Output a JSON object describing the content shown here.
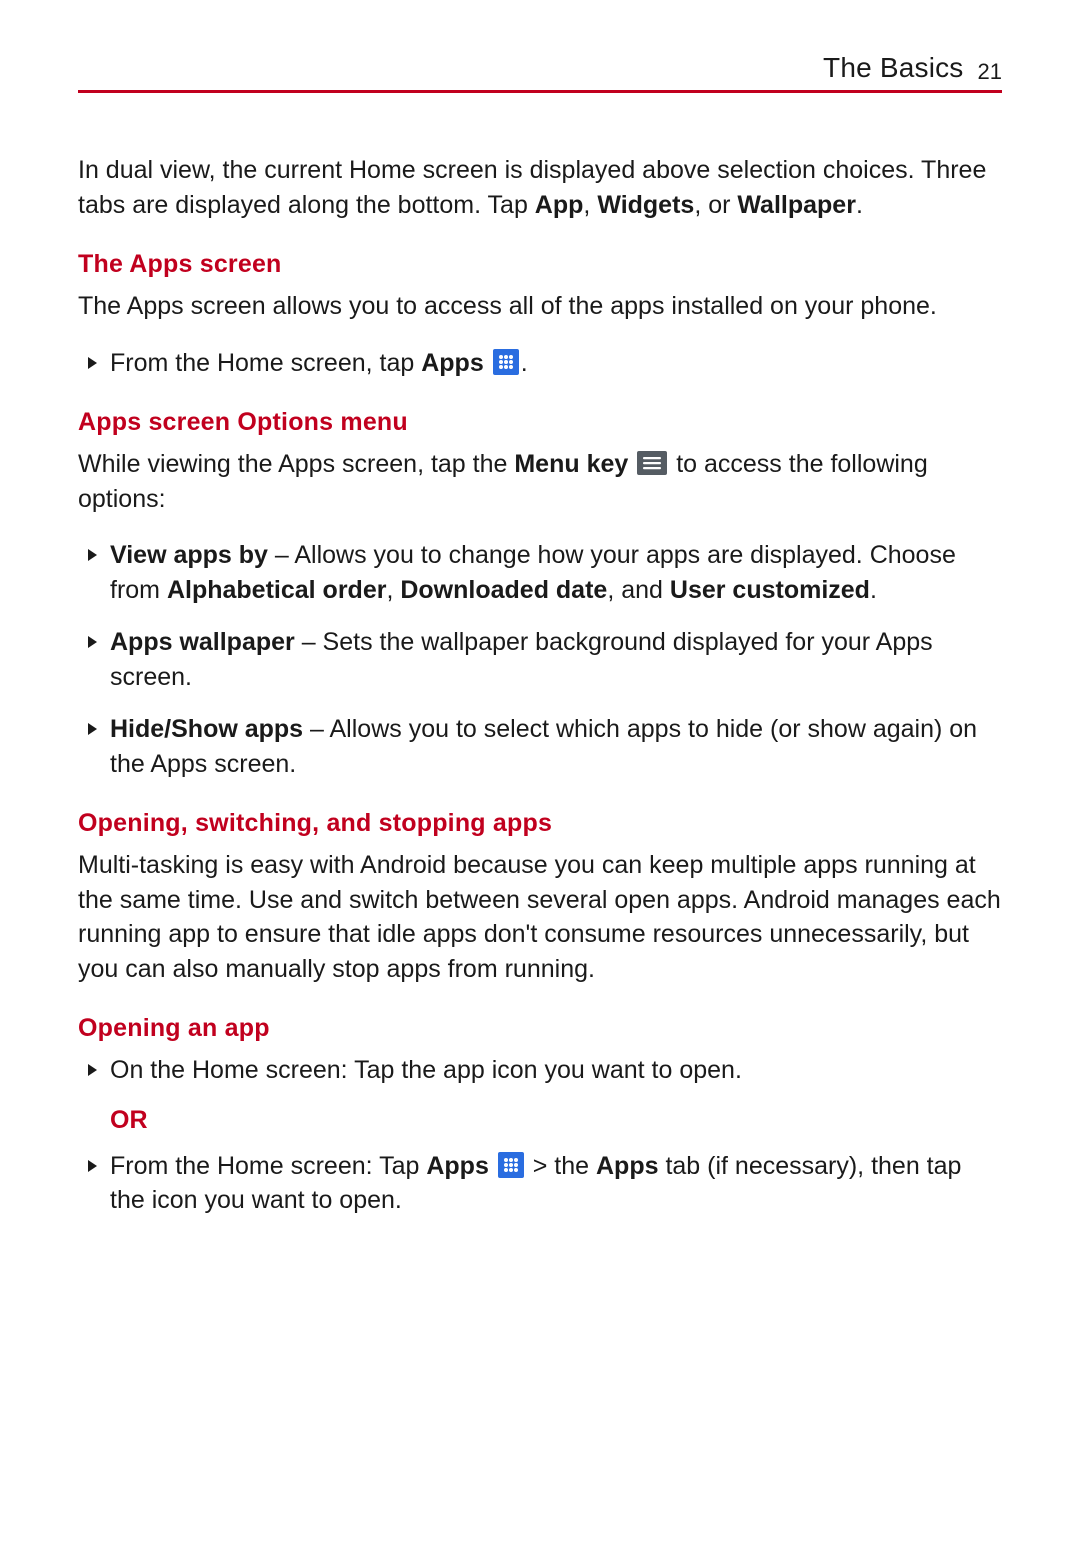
{
  "header": {
    "section": "The Basics",
    "page_number": "21"
  },
  "intro": {
    "p1_a": "In dual view, the current Home screen is displayed above selection choices. Three tabs are displayed along the bottom. Tap ",
    "p1_b": "App",
    "p1_c": ", ",
    "p1_d": "Widgets",
    "p1_e": ", or ",
    "p1_f": "Wallpaper",
    "p1_g": "."
  },
  "apps_screen": {
    "heading": "The Apps screen",
    "p1": "The Apps screen allows you to access all of the apps installed on your phone.",
    "b1_a": "From the Home screen, tap ",
    "b1_b": "Apps",
    "b1_c": "."
  },
  "options_menu": {
    "heading": "Apps screen Options menu",
    "p1_a": "While viewing the Apps screen, tap the ",
    "p1_b": "Menu key",
    "p1_c": " to access the following options:",
    "items": {
      "view": {
        "label": "View apps by",
        "a": " – Allows you to change how your apps are displayed. Choose from ",
        "b": "Alphabetical order",
        "c": ", ",
        "d": "Downloaded date",
        "e": ", and ",
        "f": "User customized",
        "g": "."
      },
      "wallpaper": {
        "label": "Apps wallpaper",
        "a": " – Sets the wallpaper background displayed for your Apps screen."
      },
      "hide": {
        "label": "Hide/Show apps",
        "a": " – Allows you to select which apps to hide (or show again) on the Apps screen."
      }
    }
  },
  "multitask": {
    "heading": "Opening, switching, and stopping apps",
    "p1": "Multi-tasking is easy with Android because you can keep multiple apps running at the same time. Use and switch between several open apps. Android manages each running app to ensure that idle apps don't consume resources unnecessarily, but you can also manually stop apps from running."
  },
  "opening": {
    "heading": "Opening an app",
    "b1": "On the Home screen: Tap the app icon you want to open.",
    "or": "OR",
    "b2_a": "From the Home screen: Tap ",
    "b2_b": "Apps",
    "b2_c": " > the ",
    "b2_d": "Apps",
    "b2_e": " tab (if necessary), then tap the icon you want to open."
  }
}
